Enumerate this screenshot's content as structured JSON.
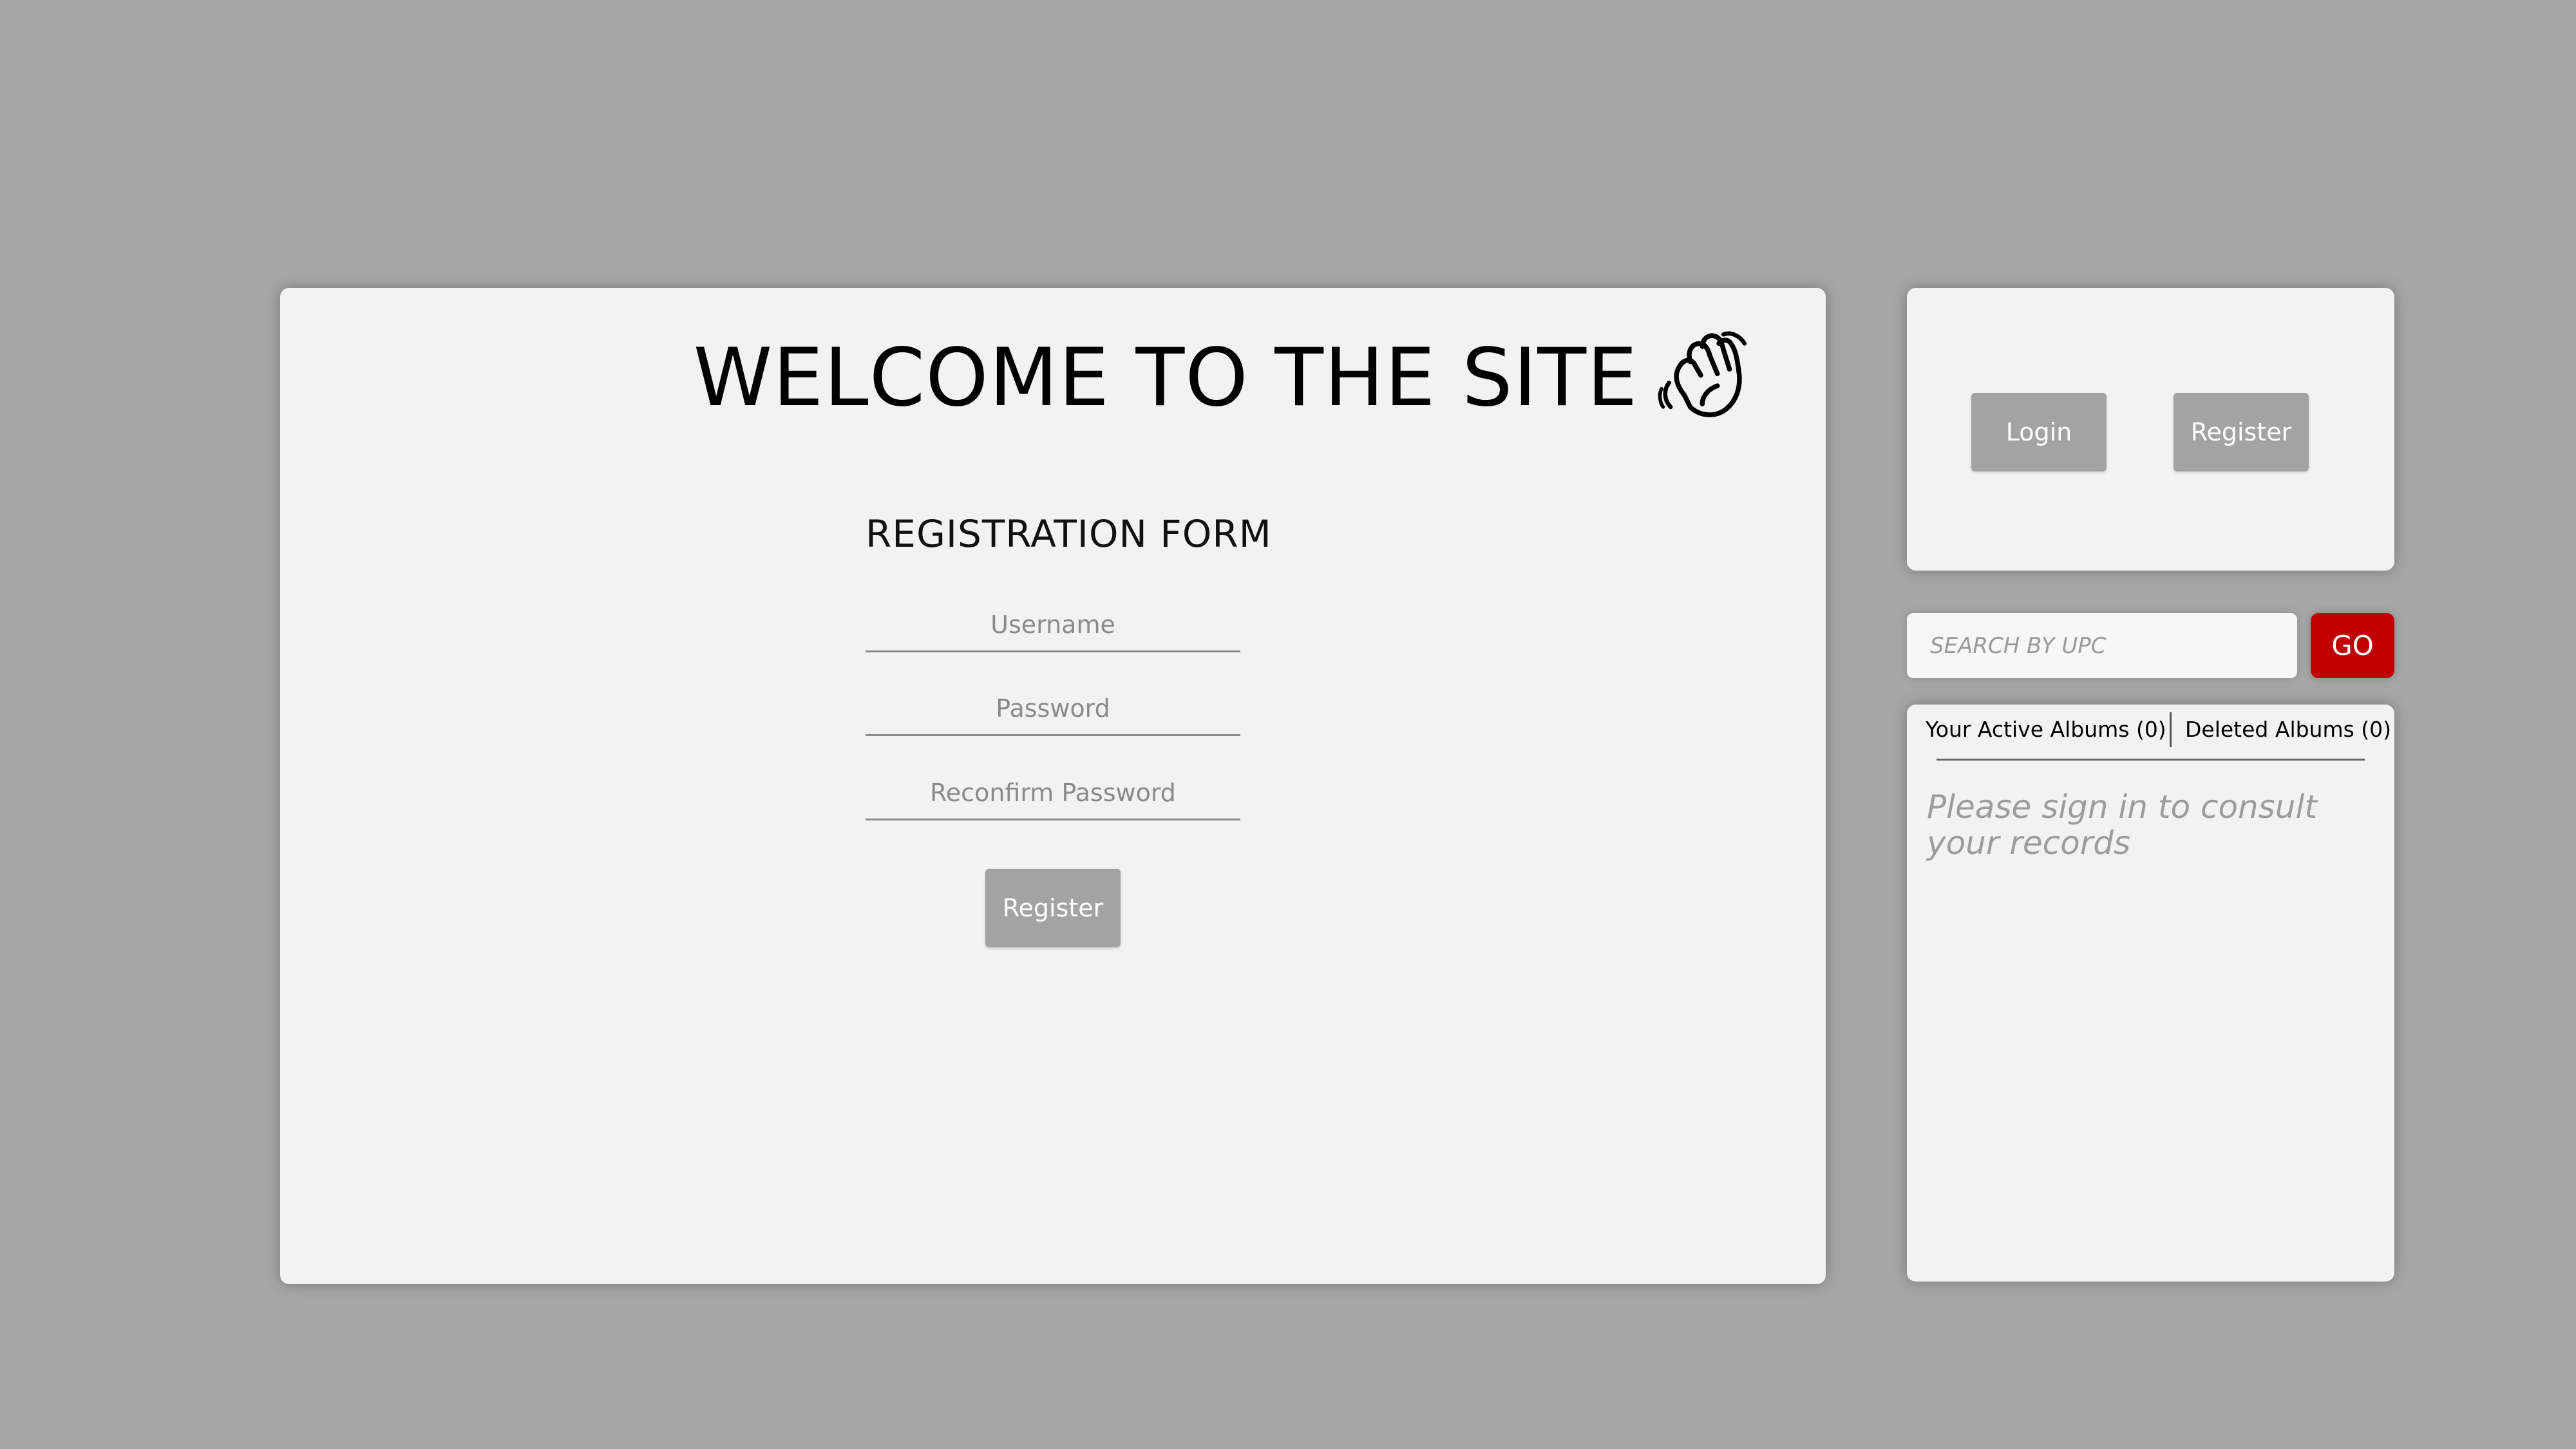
{
  "welcome": {
    "title": "WELCOME TO THE SITE"
  },
  "registration_form": {
    "heading": "REGISTRATION FORM",
    "username_placeholder": "Username",
    "password_placeholder": "Password",
    "reconfirm_placeholder": "Reconfirm Password",
    "username_value": "",
    "password_value": "",
    "reconfirm_value": "",
    "submit_label": "Register"
  },
  "auth": {
    "login_label": "Login",
    "register_label": "Register"
  },
  "search": {
    "placeholder": "SEARCH BY UPC",
    "value": "",
    "go_label": "GO"
  },
  "albums": {
    "tabs": [
      {
        "label": "Your Active Albums (0)"
      },
      {
        "label": "Deleted Albums (0)"
      }
    ],
    "empty_message": "Please sign in to consult your records"
  },
  "colors": {
    "background": "#a6a6a6",
    "panel": "#f2f2f2",
    "button": "#a3a3a3",
    "accent": "#c00000"
  },
  "icons": {
    "wave": "waving-hand-icon"
  }
}
